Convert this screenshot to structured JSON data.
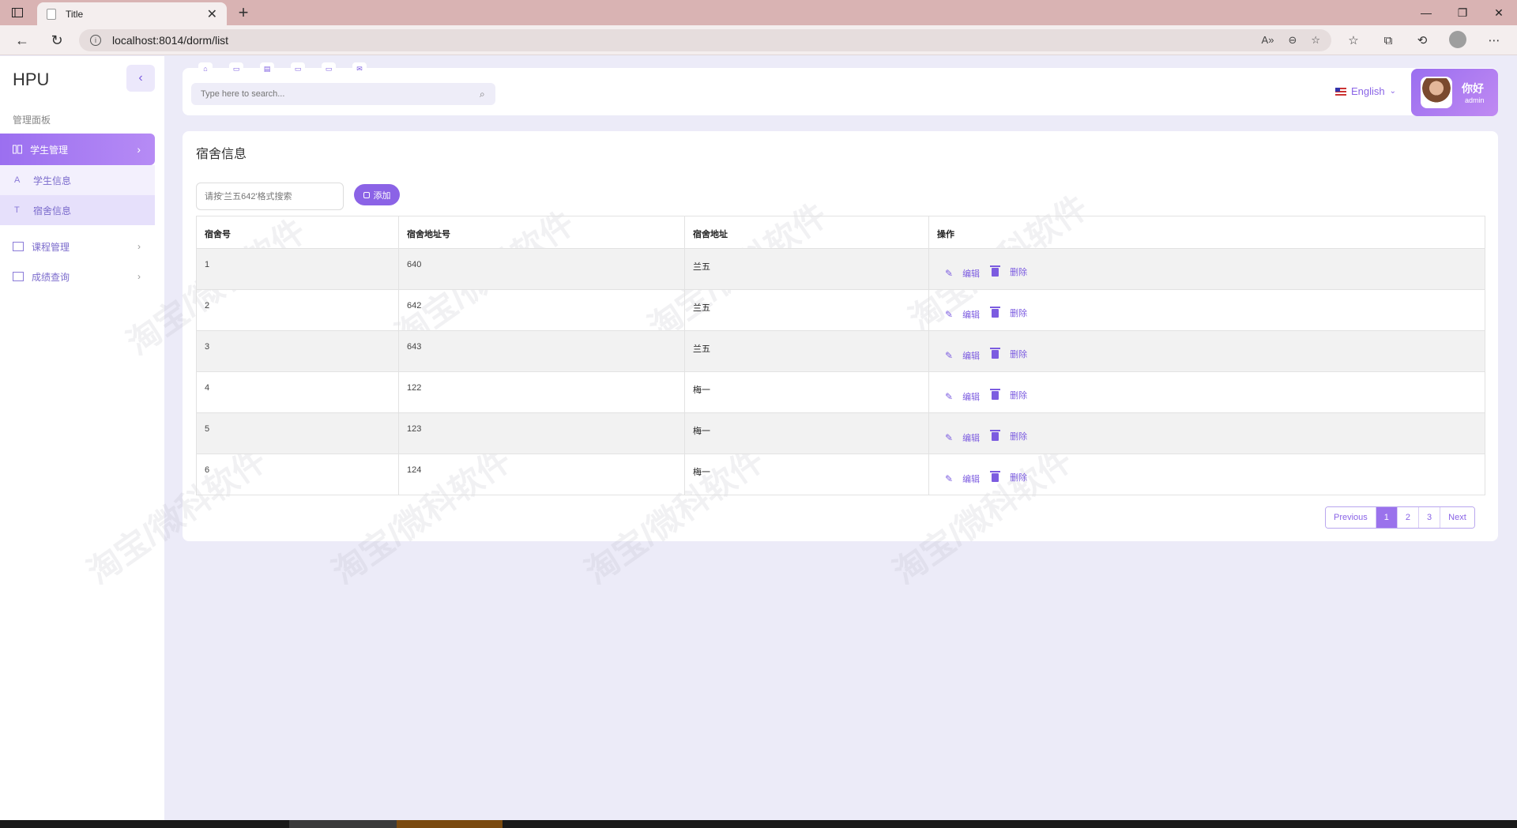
{
  "browser": {
    "tab_title": "Title",
    "url": "localhost:8014/dorm/list"
  },
  "sidebar": {
    "brand": "HPU",
    "section_label": "管理面板",
    "items": [
      {
        "label": "学生管理",
        "active": true
      },
      {
        "label": "学生信息",
        "icon_char": "A"
      },
      {
        "label": "宿舍信息",
        "icon_char": "T"
      },
      {
        "label": "课程管理"
      },
      {
        "label": "成绩查询"
      }
    ]
  },
  "topbar": {
    "search_placeholder": "Type here to search...",
    "language": "English",
    "user_greeting": "你好",
    "user_name": "admin"
  },
  "main": {
    "title": "宿舍信息",
    "filter_placeholder": "请按'兰五642'格式搜索",
    "add_label": "添加",
    "columns": [
      "宿舍号",
      "宿舍地址号",
      "宿舍地址",
      "操作"
    ],
    "rows": [
      {
        "id": "1",
        "number": "640",
        "address": "兰五"
      },
      {
        "id": "2",
        "number": "642",
        "address": "兰五"
      },
      {
        "id": "3",
        "number": "643",
        "address": "兰五"
      },
      {
        "id": "4",
        "number": "122",
        "address": "梅一"
      },
      {
        "id": "5",
        "number": "123",
        "address": "梅一"
      },
      {
        "id": "6",
        "number": "124",
        "address": "梅一"
      }
    ],
    "edit_label": "编辑",
    "delete_label": "删除",
    "pagination": {
      "previous": "Previous",
      "pages": [
        "1",
        "2",
        "3"
      ],
      "current": "1",
      "next": "Next"
    },
    "watermark": "淘宝/微科软件"
  },
  "colors": {
    "accent": "#8b63e6",
    "page_bg": "#ecebf8"
  }
}
